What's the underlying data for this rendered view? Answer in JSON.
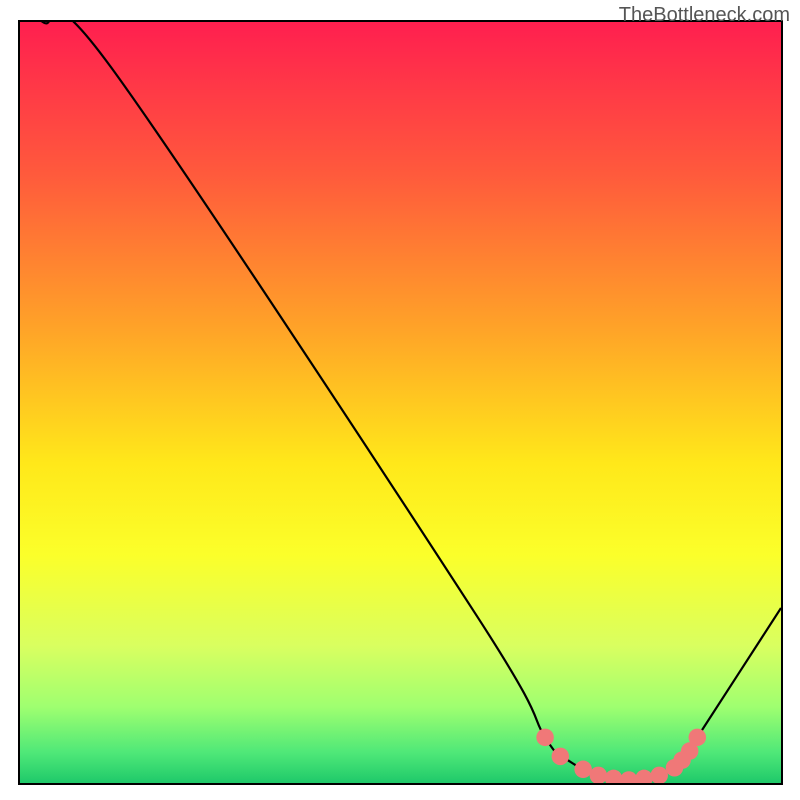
{
  "watermark": "TheBottleneck.com",
  "chart_data": {
    "type": "line",
    "title": "",
    "xlabel": "",
    "ylabel": "",
    "xlim": [
      0,
      100
    ],
    "ylim": [
      0,
      100
    ],
    "series": [
      {
        "name": "curve",
        "x": [
          0,
          3,
          12,
          60,
          69,
          72,
          76,
          80,
          84,
          87,
          89,
          100
        ],
        "y": [
          103,
          100,
          94,
          22,
          6,
          3,
          1,
          0.5,
          1,
          3,
          6,
          23
        ]
      }
    ],
    "markers": {
      "name": "highlight-points",
      "color": "#f07878",
      "x": [
        69,
        71,
        74,
        76,
        78,
        80,
        82,
        84,
        86,
        87,
        88,
        89
      ],
      "y": [
        6.0,
        3.5,
        1.8,
        1.0,
        0.6,
        0.4,
        0.6,
        1.0,
        2.0,
        3.0,
        4.2,
        6.0
      ]
    },
    "gradient_stops": [
      {
        "pos": 0.0,
        "color": "#ff1f4f"
      },
      {
        "pos": 0.2,
        "color": "#ff5a3c"
      },
      {
        "pos": 0.4,
        "color": "#ffa228"
      },
      {
        "pos": 0.58,
        "color": "#ffe81a"
      },
      {
        "pos": 0.7,
        "color": "#fbff2a"
      },
      {
        "pos": 0.82,
        "color": "#d9ff60"
      },
      {
        "pos": 0.9,
        "color": "#9fff70"
      },
      {
        "pos": 0.96,
        "color": "#4fe878"
      },
      {
        "pos": 1.0,
        "color": "#1fc96a"
      }
    ]
  }
}
